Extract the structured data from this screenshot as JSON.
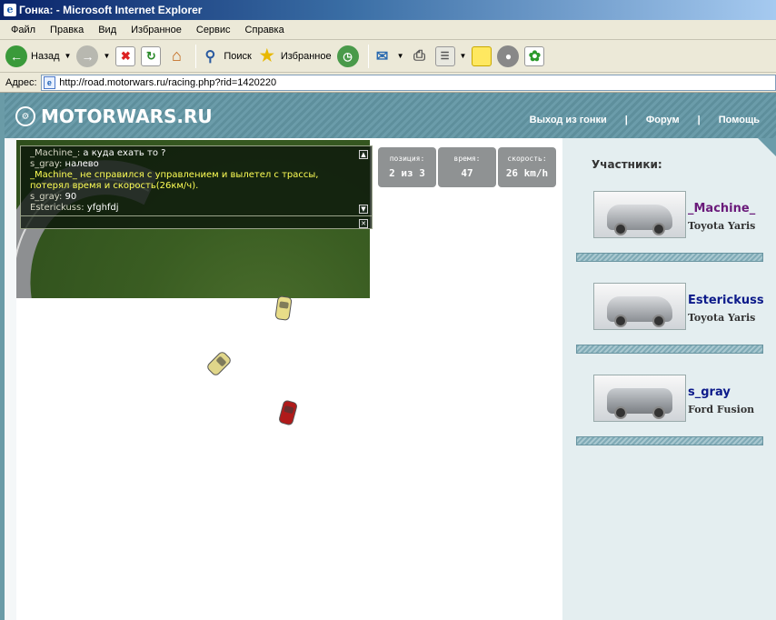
{
  "window": {
    "title": "Гонка: - Microsoft Internet Explorer"
  },
  "menu": [
    "Файл",
    "Правка",
    "Вид",
    "Избранное",
    "Сервис",
    "Справка"
  ],
  "toolbar": {
    "back_label": "Назад",
    "search_label": "Поиск",
    "favorites_label": "Избранное"
  },
  "address": {
    "label": "Адрес:",
    "url": "http://road.motorwars.ru/racing.php?rid=1420220"
  },
  "site": {
    "logo": "MOTORWARS.RU",
    "nav": [
      "Выход из гонки",
      "Форум",
      "Помощь"
    ],
    "nav_sep": "|"
  },
  "chat": {
    "lines": [
      {
        "nick": "_Machine_:",
        "msg": " а куда ехать то ?",
        "type": "normal"
      },
      {
        "nick": "s_gray:",
        "msg": " налево",
        "type": "normal"
      },
      {
        "nick": "",
        "msg": "_Machine_ не справился с управлением и вылетел с трассы,",
        "type": "system"
      },
      {
        "nick": "",
        "msg": "потерял время и скорость(26км/ч).",
        "type": "system"
      },
      {
        "nick": "s_gray:",
        "msg": " 90",
        "type": "normal"
      },
      {
        "nick": "Esterickuss:",
        "msg": " yfghfdj",
        "type": "normal"
      }
    ]
  },
  "stats": [
    {
      "label": "позиция:",
      "value": "2 из 3"
    },
    {
      "label": "время:",
      "value": "47"
    },
    {
      "label": "скорость:",
      "value": "26 km/h"
    }
  ],
  "participants": {
    "title": "Участники:",
    "list": [
      {
        "name": "_Machine_",
        "car": "Toyota Yaris",
        "color": "#6a1a7a"
      },
      {
        "name": "Esterickuss",
        "car": "Toyota Yaris",
        "color": "#0c1a8a"
      },
      {
        "name": "s_gray",
        "car": "Ford Fusion",
        "color": "#0c1a8a"
      }
    ]
  },
  "colors": {
    "header": "#5e8f9c",
    "panel": "#e4eef0",
    "chat_system": "#ffff55"
  }
}
